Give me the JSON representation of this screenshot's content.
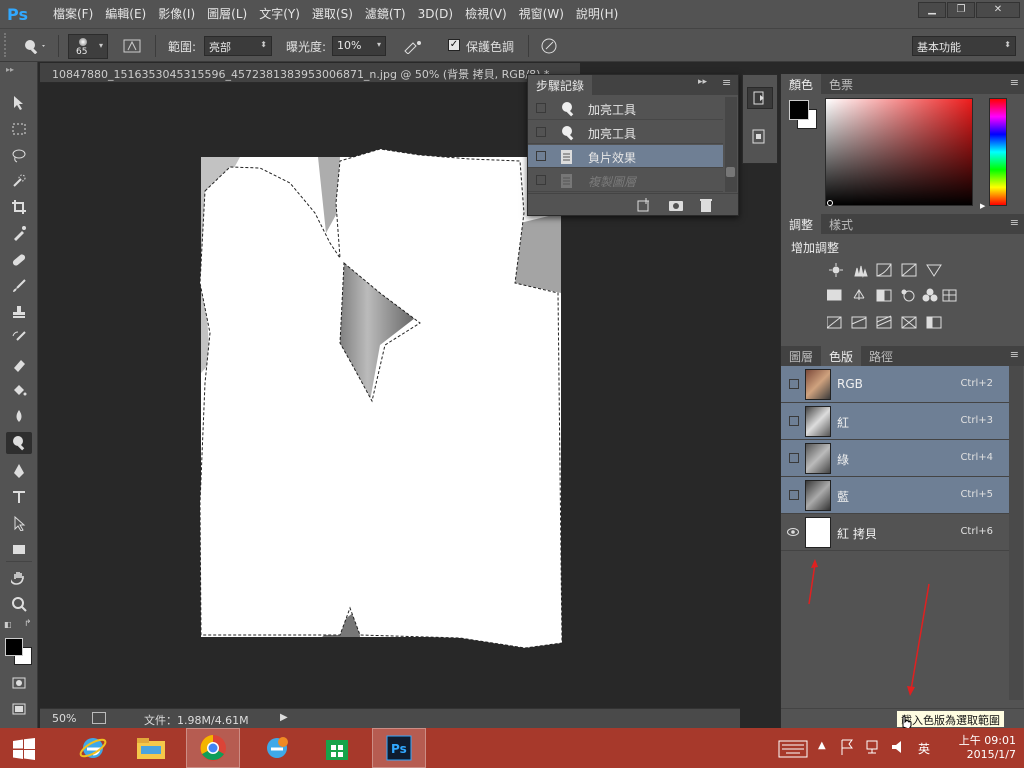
{
  "app": {
    "logo": "Ps"
  },
  "menu": [
    "檔案(F)",
    "編輯(E)",
    "影像(I)",
    "圖層(L)",
    "文字(Y)",
    "選取(S)",
    "濾鏡(T)",
    "3D(D)",
    "檢視(V)",
    "視窗(W)",
    "說明(H)"
  ],
  "options": {
    "brush_size": "65",
    "range_label": "範圍:",
    "range_value": "亮部",
    "exposure_label": "曝光度:",
    "exposure_value": "10%",
    "protect_label": "保護色調",
    "workspace": "基本功能"
  },
  "document": {
    "tab_title": "10847880_1516353045315596_4572381383953006871_n.jpg @ 50% (背景 拷貝, RGB/8) *",
    "zoom": "50%",
    "file_info": "文件：1.98M/4.61M"
  },
  "history": {
    "tab": "步驟記錄",
    "items": [
      {
        "label": "加亮工具",
        "icon": "dodge-tool-icon",
        "state": "normal"
      },
      {
        "label": "加亮工具",
        "icon": "dodge-tool-icon",
        "state": "normal"
      },
      {
        "label": "負片效果",
        "icon": "document-icon",
        "state": "selected"
      },
      {
        "label": "複製圖層",
        "icon": "document-icon",
        "state": "dim"
      }
    ]
  },
  "color_panel": {
    "tabs": [
      "顏色",
      "色票"
    ],
    "fg": "#000000",
    "bg": "#ffffff"
  },
  "adjust_panel": {
    "tabs": [
      "調整",
      "樣式"
    ],
    "heading": "增加調整"
  },
  "channels_panel": {
    "tabs": [
      "圖層",
      "色版",
      "路徑"
    ],
    "rows": [
      {
        "name": "RGB",
        "shortcut": "Ctrl+2",
        "selected": true,
        "visible": false
      },
      {
        "name": "紅",
        "shortcut": "Ctrl+3",
        "selected": true,
        "visible": false
      },
      {
        "name": "綠",
        "shortcut": "Ctrl+4",
        "selected": true,
        "visible": false
      },
      {
        "name": "藍",
        "shortcut": "Ctrl+5",
        "selected": true,
        "visible": false
      },
      {
        "name": "紅 拷貝",
        "shortcut": "Ctrl+6",
        "selected": false,
        "visible": true
      }
    ],
    "tooltip": "載入色版為選取範圍"
  },
  "taskbar": {
    "time": "上午 09:01",
    "date": "2015/1/7",
    "ime": "英"
  },
  "colors": {
    "accent": "#31a8ff",
    "selected_row": "#6e7f95",
    "taskbar": "#a7392b",
    "annotation": "#e02020"
  }
}
